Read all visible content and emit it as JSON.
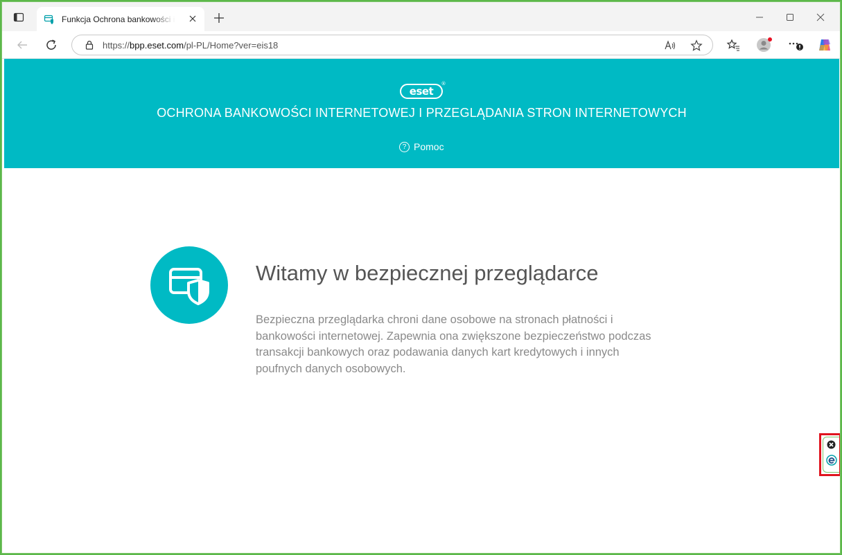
{
  "browser": {
    "tab": {
      "title": "Funkcja Ochrona bankowości internetowej"
    },
    "address": {
      "prefix": "https://",
      "host": "bpp.eset.com",
      "path": "/pl-PL/Home?ver=eis18"
    }
  },
  "header": {
    "logo": "eset",
    "title": "OCHRONA BANKOWOŚCI INTERNETOWEJ I PRZEGLĄDANIA STRON INTERNETOWYCH",
    "help_label": "Pomoc"
  },
  "main": {
    "title": "Witamy w bezpiecznej przeglądarce",
    "body": "Bezpieczna przeglądarka chroni dane osobowe na stronach płatności i bankowości internetowej. Zapewnia ona zwiększone bezpieczeństwo podczas transakcji bankowych oraz podawania danych kart kredytowych i innych poufnych danych osobowych."
  },
  "colors": {
    "accent": "#00bac4",
    "text_title": "#555555",
    "text_body": "#8a8a8a",
    "highlight": "#e0141e"
  },
  "icons": [
    "tab-actions-icon",
    "favicon-icon",
    "close-icon",
    "plus-icon",
    "minimize-icon",
    "maximize-icon",
    "back-icon",
    "refresh-icon",
    "lock-icon",
    "read-aloud-icon",
    "star-icon",
    "favorites-icon",
    "profile-icon",
    "more-icon",
    "copilot-icon",
    "help-icon",
    "card-shield-icon",
    "eset-icon"
  ]
}
